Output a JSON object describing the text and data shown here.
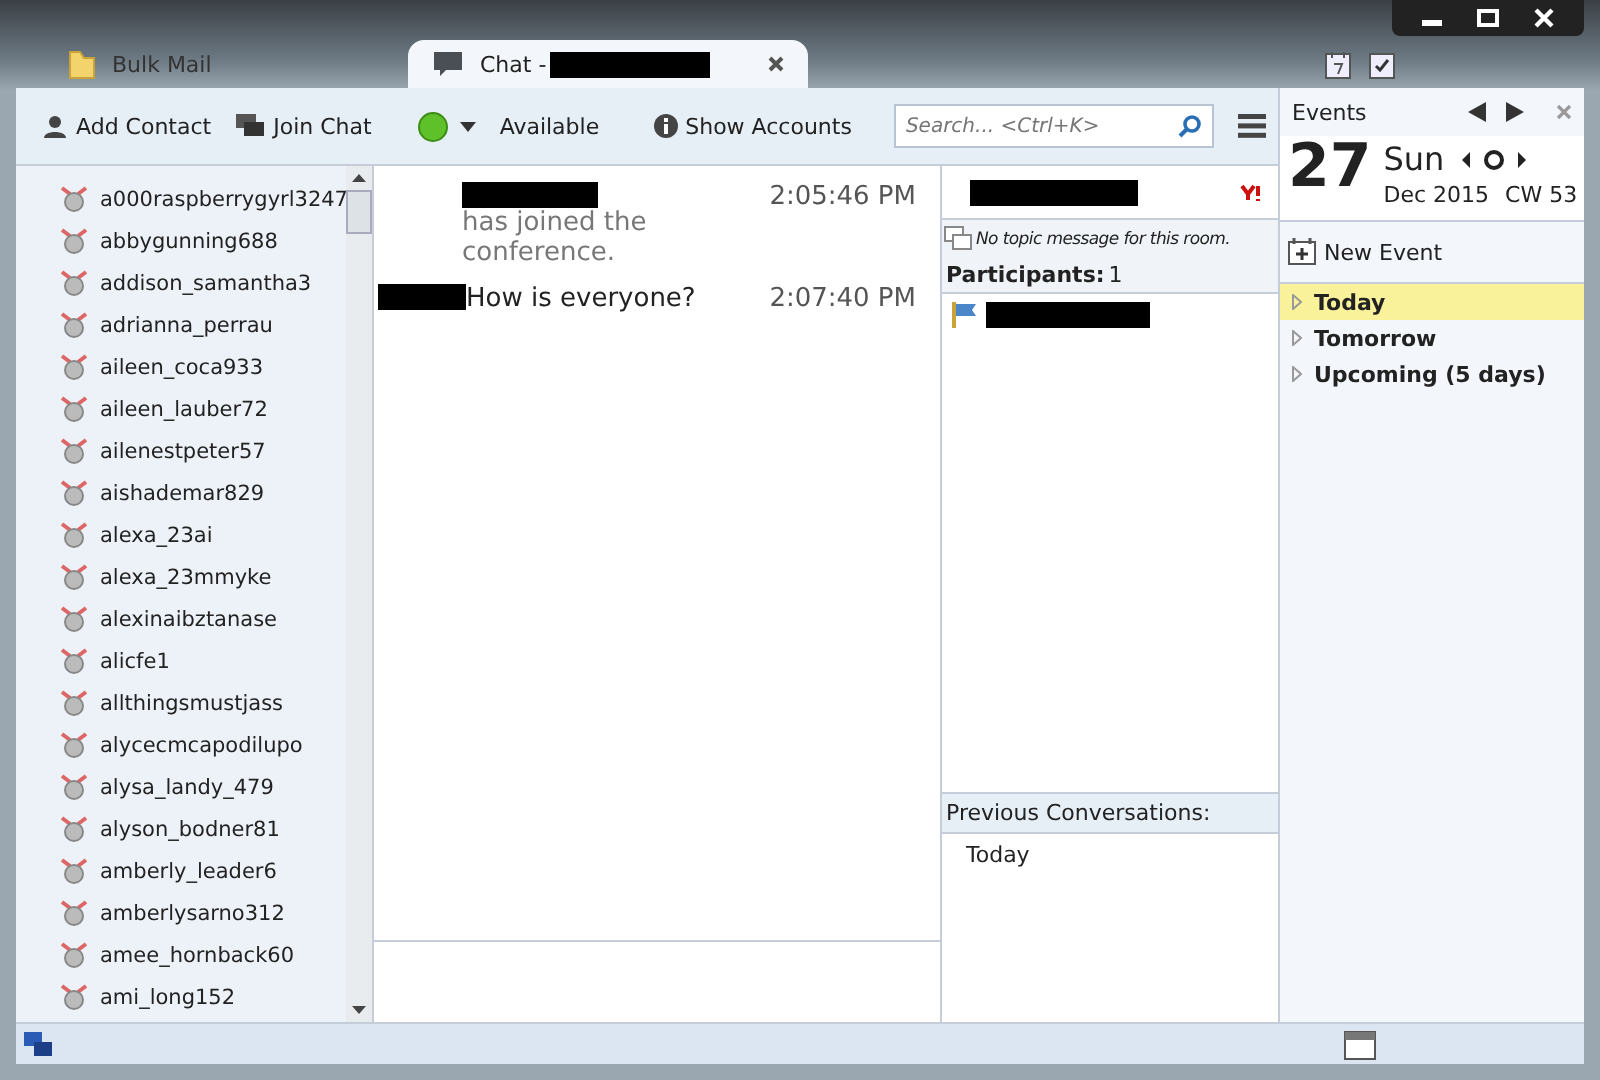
{
  "tabs": [
    {
      "label": "Bulk Mail",
      "selected": false,
      "kind": "mail"
    },
    {
      "label": "Chat - ",
      "selected": true,
      "kind": "chat"
    }
  ],
  "toolbar": {
    "add_contact": "Add Contact",
    "join_chat": "Join Chat",
    "status": "Available",
    "show_accounts": "Show Accounts",
    "search": {
      "placeholder": "Search... <Ctrl+K>"
    }
  },
  "contacts": [
    "a000raspberrygyrl3247",
    "abbygunning688",
    "addison_samantha3",
    "adrianna_perrau",
    "aileen_coca933",
    "aileen_lauber72",
    "ailenestpeter57",
    "aishademar829",
    "alexa_23ai",
    "alexa_23mmyke",
    "alexinaibztanase",
    "alicfe1",
    "allthingsmustjass",
    "alycecmcapodilupo",
    "alysa_landy_479",
    "alyson_bodner81",
    "amberly_leader6",
    "amberlysarno312",
    "amee_hornback60",
    "ami_long152"
  ],
  "messages": [
    {
      "kind": "system",
      "text": "has joined the conference.",
      "time": "2:05:46 PM"
    },
    {
      "kind": "message",
      "text": "How is everyone?",
      "time": "2:07:40 PM"
    }
  ],
  "room": {
    "topic": "No topic message for this room.",
    "participants_label": "Participants:",
    "participants_count": "1",
    "previous_label": "Previous Conversations:",
    "previous": [
      "Today"
    ]
  },
  "events": {
    "title": "Events",
    "day": "27",
    "weekday": "Sun",
    "month": "Dec 2015",
    "week": "CW 53",
    "new_event": "New Event",
    "groups": [
      {
        "label": "Today",
        "selected": true
      },
      {
        "label": "Tomorrow",
        "selected": false
      },
      {
        "label": "Upcoming (5 days)",
        "selected": false
      }
    ]
  }
}
